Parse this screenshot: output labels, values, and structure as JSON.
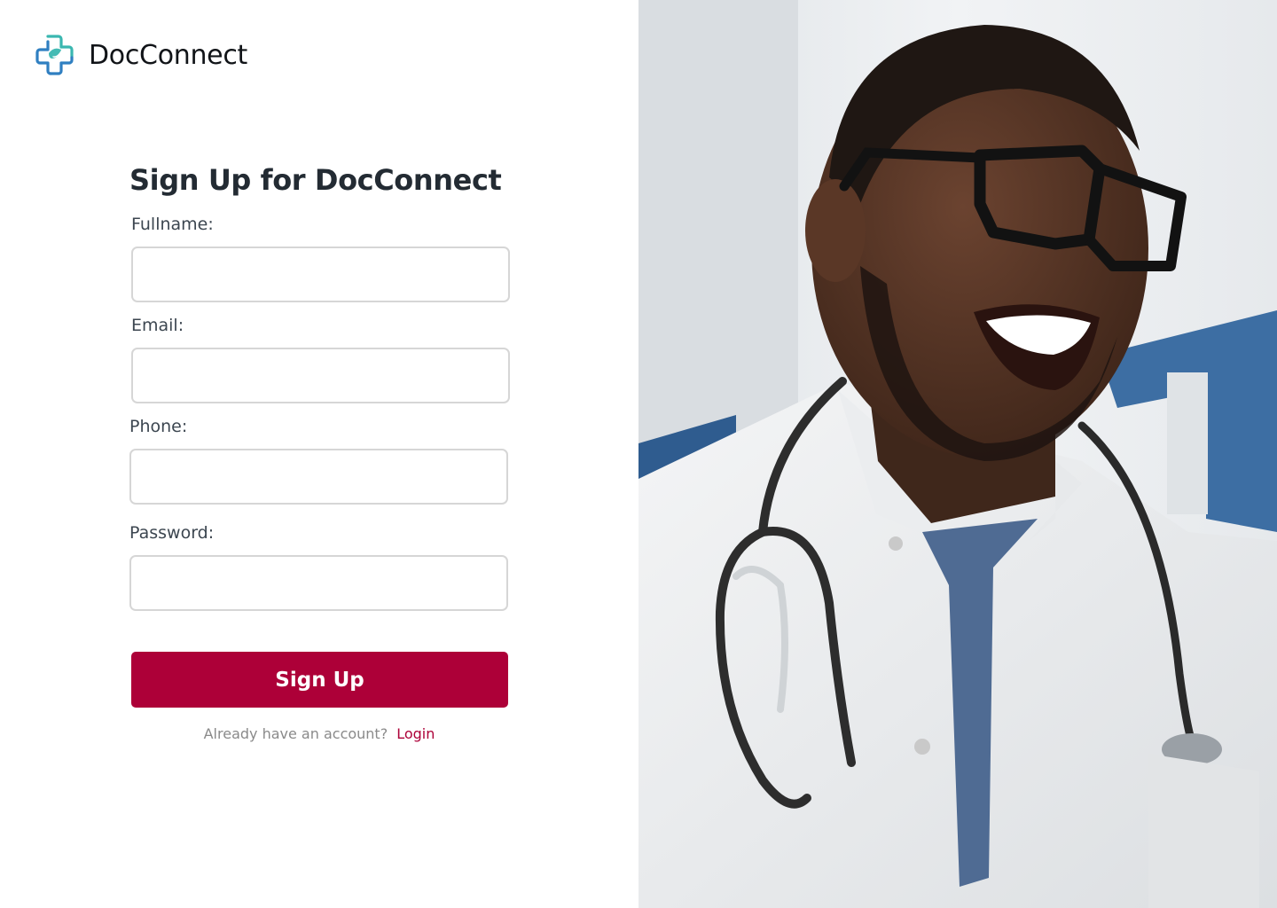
{
  "brand": {
    "name": "DocConnect",
    "logo_icon": "medical-cross-icon",
    "colors": {
      "logo_teal": "#3ab7b0",
      "logo_blue": "#2f7fc1"
    }
  },
  "form": {
    "title": "Sign Up for DocConnect",
    "fields": {
      "fullname": {
        "label": "Fullname:",
        "value": "",
        "placeholder": ""
      },
      "email": {
        "label": "Email:",
        "value": "",
        "placeholder": ""
      },
      "phone": {
        "label": "Phone:",
        "value": "",
        "placeholder": ""
      },
      "password": {
        "label": "Password:",
        "value": "",
        "placeholder": ""
      }
    },
    "submit_label": "Sign Up"
  },
  "footer": {
    "prompt": "Already have an account?",
    "login_link": "Login"
  },
  "hero": {
    "image_subject": "smiling doctor in white coat with glasses and stethoscope"
  },
  "colors": {
    "primary": "#ad0038",
    "text_dark": "#232b33",
    "input_border": "#d6d6d6"
  }
}
